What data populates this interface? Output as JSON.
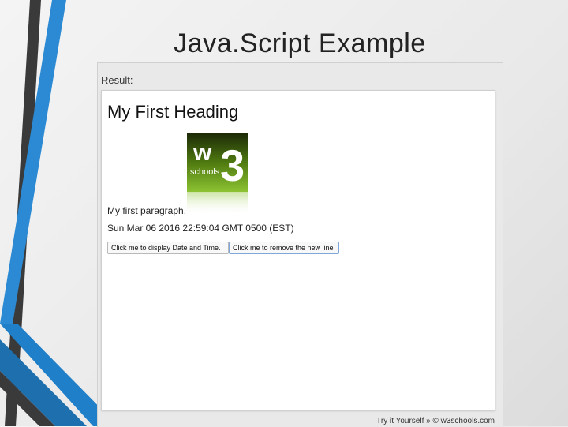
{
  "slide": {
    "title": "Java.Script Example"
  },
  "panel": {
    "result_label": "Result:",
    "heading": "My First Heading",
    "logo": {
      "top_text": "w",
      "main_text": "3",
      "sub_text": "schools",
      "accent_color": "#7fb020"
    },
    "paragraph": "My first paragraph.",
    "datetime": "Sun Mar 06 2016 22:59:04 GMT 0500 (EST)",
    "buttons": {
      "display_date": "Click me to display Date and Time.",
      "remove_line": "Click me to remove the new line"
    },
    "footer": "Try it Yourself » © w3schools.com"
  },
  "colors": {
    "deco_blue": "#1f7fc8",
    "deco_dark": "#3a3a3a"
  }
}
